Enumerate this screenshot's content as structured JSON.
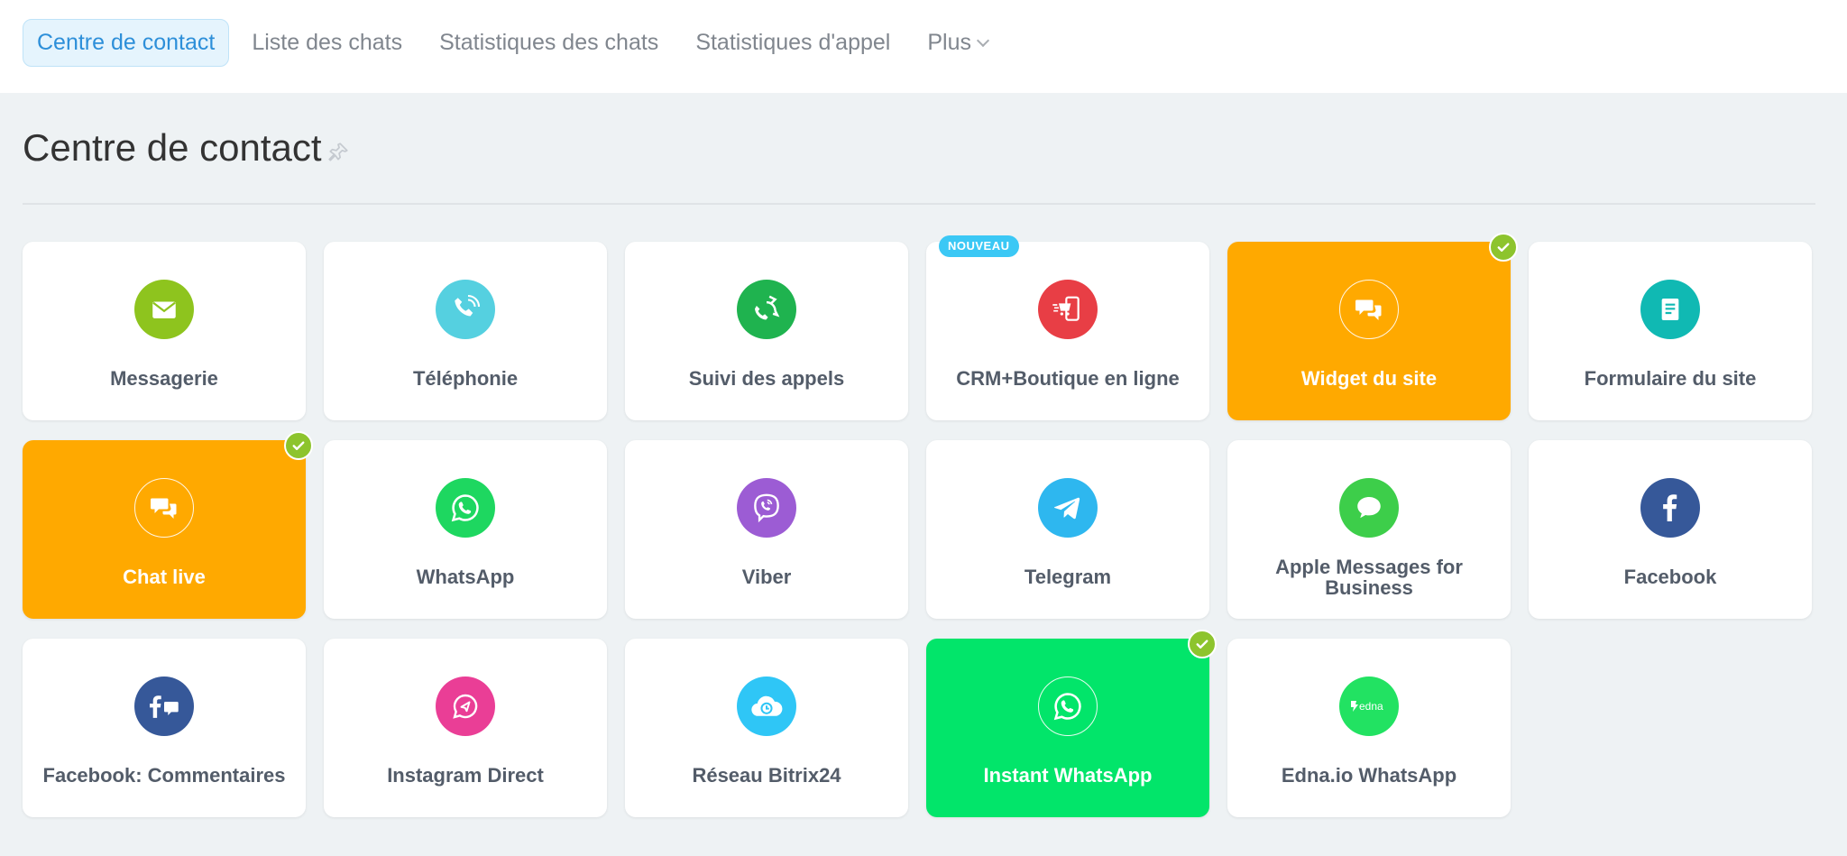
{
  "nav": {
    "tabs": [
      {
        "label": "Centre de contact",
        "active": true
      },
      {
        "label": "Liste des chats"
      },
      {
        "label": "Statistiques des chats"
      },
      {
        "label": "Statistiques d'appel"
      },
      {
        "label": "Plus"
      }
    ]
  },
  "page": {
    "title": "Centre de contact"
  },
  "tiles": [
    {
      "label": "Messagerie",
      "icon": "envelope-icon",
      "color": "#8ec41e"
    },
    {
      "label": "Téléphonie",
      "icon": "phone-icon",
      "color": "#55d0e0"
    },
    {
      "label": "Suivi des appels",
      "icon": "call-tracking-icon",
      "color": "#1fb34f"
    },
    {
      "label": "CRM+Boutique en ligne",
      "icon": "shop-cart-icon",
      "color": "#e83e45",
      "badge": "NOUVEAU"
    },
    {
      "label": "Widget du site",
      "icon": "chat-bubbles-icon",
      "color": "#ffa900",
      "selected": true
    },
    {
      "label": "Formulaire du site",
      "icon": "form-icon",
      "color": "#10b9b3"
    },
    {
      "label": "Chat live",
      "icon": "chat-bubbles-icon",
      "color": "#ffa900",
      "selected": true
    },
    {
      "label": "WhatsApp",
      "icon": "whatsapp-icon",
      "color": "#1ed760"
    },
    {
      "label": "Viber",
      "icon": "viber-icon",
      "color": "#9c5cd4"
    },
    {
      "label": "Telegram",
      "icon": "telegram-icon",
      "color": "#2eb7ef"
    },
    {
      "label": "Apple Messages for Business",
      "icon": "apple-messages-icon",
      "color": "#3dce4a"
    },
    {
      "label": "Facebook",
      "icon": "facebook-icon",
      "color": "#365899"
    },
    {
      "label": "Facebook: Commentaires",
      "icon": "facebook-comments-icon",
      "color": "#365899"
    },
    {
      "label": "Instagram Direct",
      "icon": "instagram-direct-icon",
      "color": "#ea3e96"
    },
    {
      "label": "Réseau Bitrix24",
      "icon": "bitrix-cloud-icon",
      "color": "#2fc6f6"
    },
    {
      "label": "Instant WhatsApp",
      "icon": "whatsapp-icon",
      "color": "#02e56a",
      "selected": true
    },
    {
      "label": "Edna.io WhatsApp",
      "icon": "edna-icon",
      "color": "#22e262"
    }
  ],
  "badge_text": "NOUVEAU"
}
